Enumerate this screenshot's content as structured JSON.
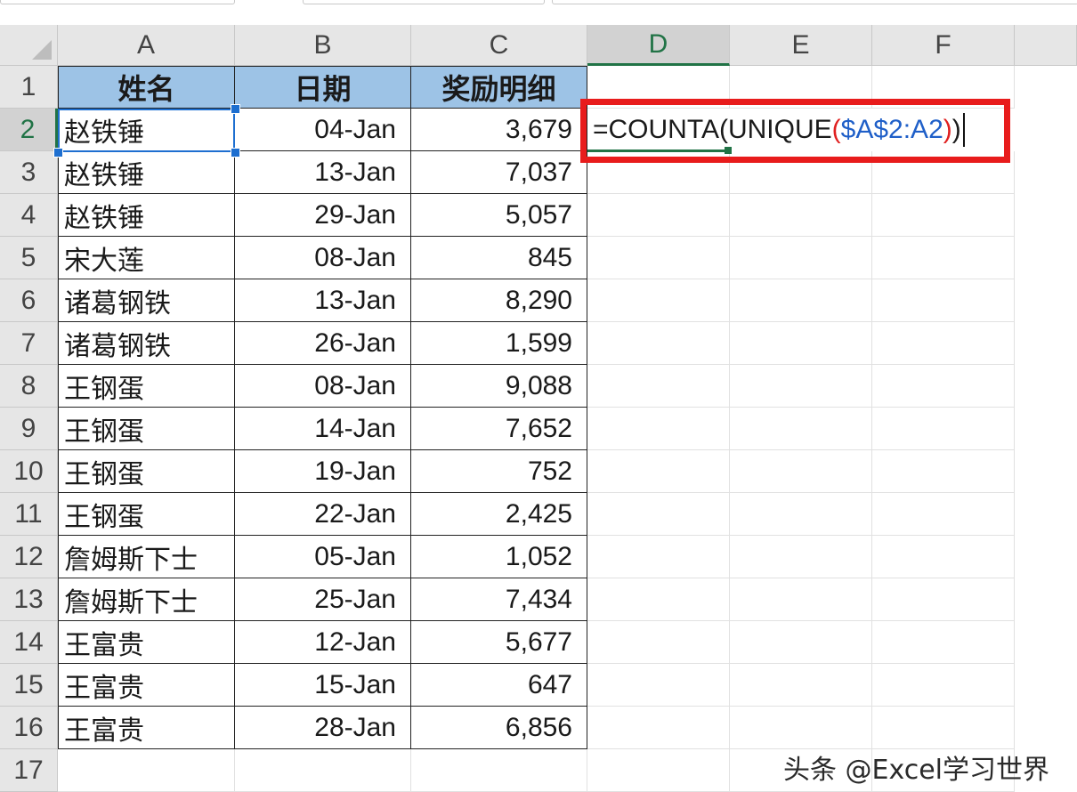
{
  "columns": [
    "A",
    "B",
    "C",
    "D",
    "E",
    "F"
  ],
  "rows": [
    "1",
    "2",
    "3",
    "4",
    "5",
    "6",
    "7",
    "8",
    "9",
    "10",
    "11",
    "12",
    "13",
    "14",
    "15",
    "16",
    "17"
  ],
  "table": {
    "headers": [
      "姓名",
      "日期",
      "奖励明细"
    ],
    "records": [
      {
        "name": "赵铁锤",
        "date": "04-Jan",
        "amount": "3,679"
      },
      {
        "name": "赵铁锤",
        "date": "13-Jan",
        "amount": "7,037"
      },
      {
        "name": "赵铁锤",
        "date": "29-Jan",
        "amount": "5,057"
      },
      {
        "name": "宋大莲",
        "date": "08-Jan",
        "amount": "845"
      },
      {
        "name": "诸葛钢铁",
        "date": "13-Jan",
        "amount": "8,290"
      },
      {
        "name": "诸葛钢铁",
        "date": "26-Jan",
        "amount": "1,599"
      },
      {
        "name": "王钢蛋",
        "date": "08-Jan",
        "amount": "9,088"
      },
      {
        "name": "王钢蛋",
        "date": "14-Jan",
        "amount": "7,652"
      },
      {
        "name": "王钢蛋",
        "date": "19-Jan",
        "amount": "752"
      },
      {
        "name": "王钢蛋",
        "date": "22-Jan",
        "amount": "2,425"
      },
      {
        "name": "詹姆斯下士",
        "date": "05-Jan",
        "amount": "1,052"
      },
      {
        "name": "詹姆斯下士",
        "date": "25-Jan",
        "amount": "7,434"
      },
      {
        "name": "王富贵",
        "date": "12-Jan",
        "amount": "5,677"
      },
      {
        "name": "王富贵",
        "date": "15-Jan",
        "amount": "647"
      },
      {
        "name": "王富贵",
        "date": "28-Jan",
        "amount": "6,856"
      }
    ]
  },
  "formula": {
    "part1": "=COUNTA",
    "paren1": "(",
    "part2": "UNIQUE",
    "paren2": "(",
    "ref": "$A$2:A2",
    "paren3": ")",
    "paren4": ")"
  },
  "active_column": "D",
  "active_row": "2",
  "watermark": "头条 @Excel学习世界",
  "colors": {
    "header_fill": "#9dc3e6",
    "selection": "#1e6fd0",
    "excel_green": "#217346",
    "highlight_red": "#e81c1c",
    "formula_ref": "#1f5fc8",
    "formula_paren": "#e02020"
  }
}
